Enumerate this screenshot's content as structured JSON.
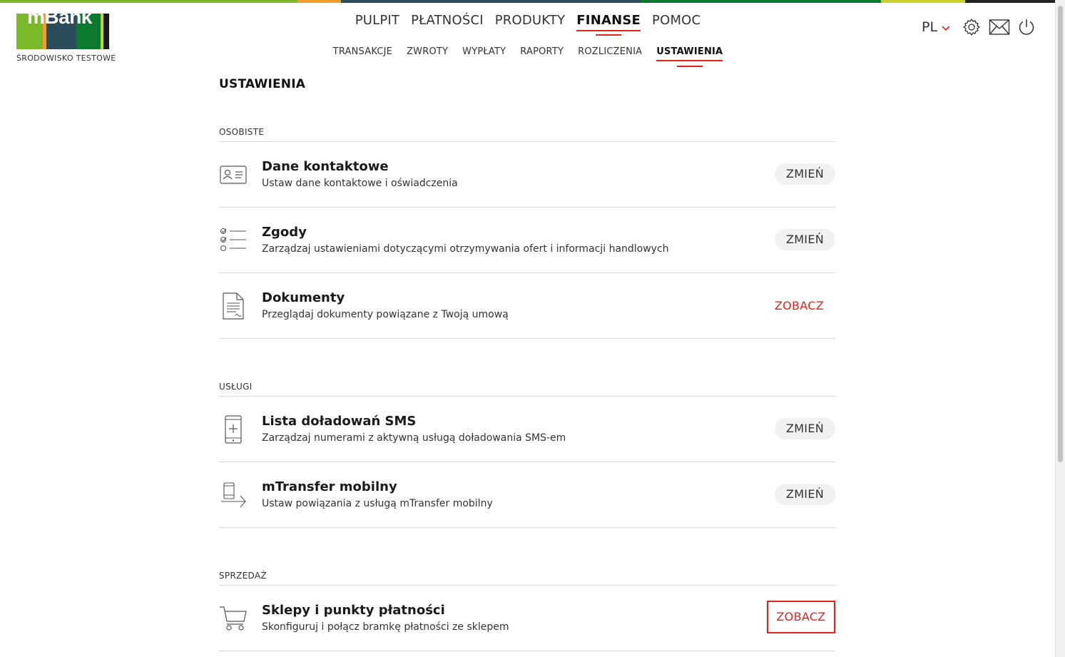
{
  "colors": {
    "accent": "#e2231a",
    "stripe": [
      "#7ab929",
      "#f39c2a",
      "#2b4c5a",
      "#0b7a2e",
      "#c8d22b",
      "#222222"
    ],
    "logo_bars": [
      "#7ab929",
      "#f39c2a",
      "#2b4c5a",
      "#0b7a2e",
      "#c8d22b",
      "#1a1a1a"
    ]
  },
  "brand": {
    "logo_text": "mBank",
    "environment": "ŚRODOWISKO TESTOWE"
  },
  "main_nav": {
    "items": [
      {
        "label": "PULPIT"
      },
      {
        "label": "PŁATNOŚCI"
      },
      {
        "label": "PRODUKTY"
      },
      {
        "label": "FINANSE",
        "active": true
      },
      {
        "label": "POMOC"
      }
    ]
  },
  "sub_nav": {
    "items": [
      {
        "label": "TRANSAKCJE"
      },
      {
        "label": "ZWROTY"
      },
      {
        "label": "WYPŁATY"
      },
      {
        "label": "RAPORTY"
      },
      {
        "label": "ROZLICZENIA"
      },
      {
        "label": "USTAWIENIA",
        "active": true
      }
    ]
  },
  "header_right": {
    "language": "PL",
    "icons": [
      "chevron-down-icon",
      "gear-icon",
      "mail-icon",
      "power-icon"
    ]
  },
  "page": {
    "title": "USTAWIENIA",
    "sections": [
      {
        "label": "OSOBISTE",
        "rows": [
          {
            "icon": "contact-card-icon",
            "title": "Dane kontaktowe",
            "desc": "Ustaw dane kontaktowe i oświadczenia",
            "action": "ZMIEŃ"
          },
          {
            "icon": "checklist-icon",
            "title": "Zgody",
            "desc": "Zarządzaj ustawieniami dotyczącymi otrzymywania ofert i informacji handlowych",
            "action": "ZMIEŃ"
          },
          {
            "icon": "document-icon",
            "title": "Dokumenty",
            "desc": "Przeglądaj dokumenty powiązane z Twoją umową",
            "action": "ZOBACZ"
          }
        ]
      },
      {
        "label": "USŁUGI",
        "rows": [
          {
            "icon": "phone-plus-icon",
            "title": "Lista doładowań SMS",
            "desc": "Zarządzaj numerami z aktywną usługą doładowania SMS-em",
            "action": "ZMIEŃ"
          },
          {
            "icon": "phone-transfer-icon",
            "title": "mTransfer mobilny",
            "desc": "Ustaw powiązania z usługą mTransfer mobilny",
            "action": "ZMIEŃ"
          }
        ]
      },
      {
        "label": "SPRZEDAŻ",
        "rows": [
          {
            "icon": "cart-icon",
            "title": "Sklepy i punkty płatności",
            "desc": "Skonfiguruj i połącz bramkę płatności ze sklepem",
            "action": "ZOBACZ"
          }
        ]
      }
    ]
  }
}
